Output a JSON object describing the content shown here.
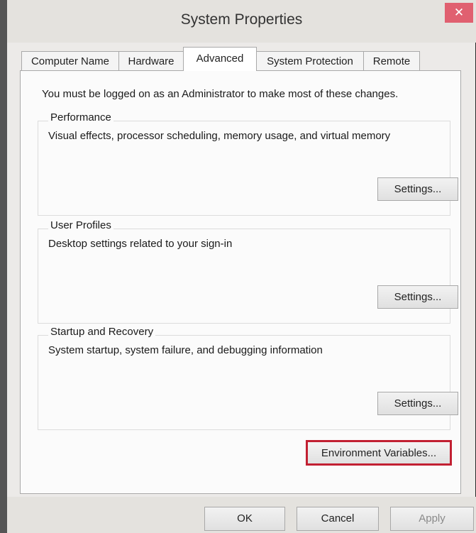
{
  "window": {
    "title": "System Properties",
    "close_glyph": "✕"
  },
  "tabs": [
    {
      "label": "Computer Name",
      "active": false
    },
    {
      "label": "Hardware",
      "active": false
    },
    {
      "label": "Advanced",
      "active": true
    },
    {
      "label": "System Protection",
      "active": false
    },
    {
      "label": "Remote",
      "active": false
    }
  ],
  "panel": {
    "admin_note": "You must be logged on as an Administrator to make most of these changes.",
    "groups": [
      {
        "title": "Performance",
        "description": "Visual effects, processor scheduling, memory usage, and virtual memory",
        "button": "Settings..."
      },
      {
        "title": "User Profiles",
        "description": "Desktop settings related to your sign-in",
        "button": "Settings..."
      },
      {
        "title": "Startup and Recovery",
        "description": "System startup, system failure, and debugging information",
        "button": "Settings..."
      }
    ],
    "env_button": "Environment Variables..."
  },
  "footer": {
    "ok": "OK",
    "cancel": "Cancel",
    "apply": "Apply"
  },
  "colors": {
    "highlight": "#c22032",
    "close": "#e06070"
  }
}
